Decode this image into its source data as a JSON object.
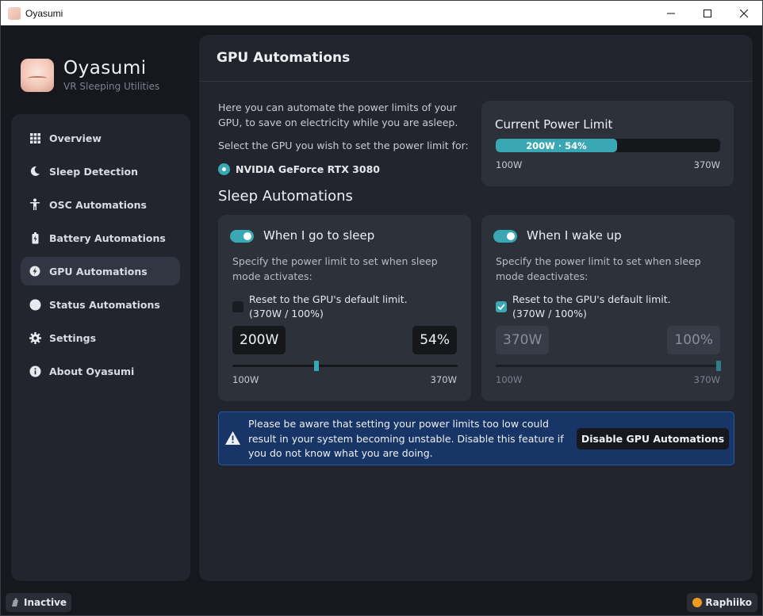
{
  "window": {
    "title": "Oyasumi",
    "minimize": "—",
    "maximize": "☐",
    "close": "✕"
  },
  "brand": {
    "name": "Oyasumi",
    "subtitle": "VR Sleeping Utilities"
  },
  "sidebar": {
    "items": [
      {
        "label": "Overview",
        "icon": "grid-icon"
      },
      {
        "label": "Sleep Detection",
        "icon": "moon-icon"
      },
      {
        "label": "OSC Automations",
        "icon": "person-icon"
      },
      {
        "label": "Battery Automations",
        "icon": "battery-icon"
      },
      {
        "label": "GPU Automations",
        "icon": "bolt-icon",
        "active": true
      },
      {
        "label": "Status Automations",
        "icon": "circle-icon"
      },
      {
        "label": "Settings",
        "icon": "gear-icon"
      },
      {
        "label": "About Oyasumi",
        "icon": "info-icon"
      }
    ]
  },
  "main": {
    "title": "GPU Automations",
    "intro": "Here you can automate the power limits of your GPU, to save on electricity while you are asleep.",
    "select_prompt": "Select the GPU you wish to set the power limit for:",
    "gpu_name": "NVIDIA GeForce RTX 3080",
    "power_card": {
      "title": "Current Power Limit",
      "bar_label": "200W · 54%",
      "fill_fraction": 0.54,
      "min_label": "100W",
      "max_label": "370W"
    },
    "section_title": "Sleep Automations",
    "sleep_card": {
      "title": "When I go to sleep",
      "enabled": true,
      "description": "Specify the power limit to set when sleep mode activates:",
      "reset_label_1": "Reset to the GPU's default limit.",
      "reset_label_2": "(370W / 100%)",
      "reset_checked": false,
      "watts": "200W",
      "percent": "54%",
      "slider_fraction": 0.37,
      "min_label": "100W",
      "max_label": "370W"
    },
    "wake_card": {
      "title": "When I wake up",
      "enabled": true,
      "description": "Specify the power limit to set when sleep mode deactivates:",
      "reset_label_1": "Reset to the GPU's default limit.",
      "reset_label_2": "(370W / 100%)",
      "reset_checked": true,
      "watts": "370W",
      "percent": "100%",
      "slider_fraction": 1.0,
      "min_label": "100W",
      "max_label": "370W"
    },
    "warning": {
      "text": "Please be aware that setting your power limits too low could result in your system becoming unstable. Disable this feature if you do not know what you are doing.",
      "button": "Disable GPU Automations"
    }
  },
  "statusbar": {
    "sleep_state": "Inactive",
    "user": "Raphiiko"
  },
  "colors": {
    "accent": "#3aa7b4",
    "warning_bg": "#173567",
    "user_dot": "#f39a1e"
  }
}
